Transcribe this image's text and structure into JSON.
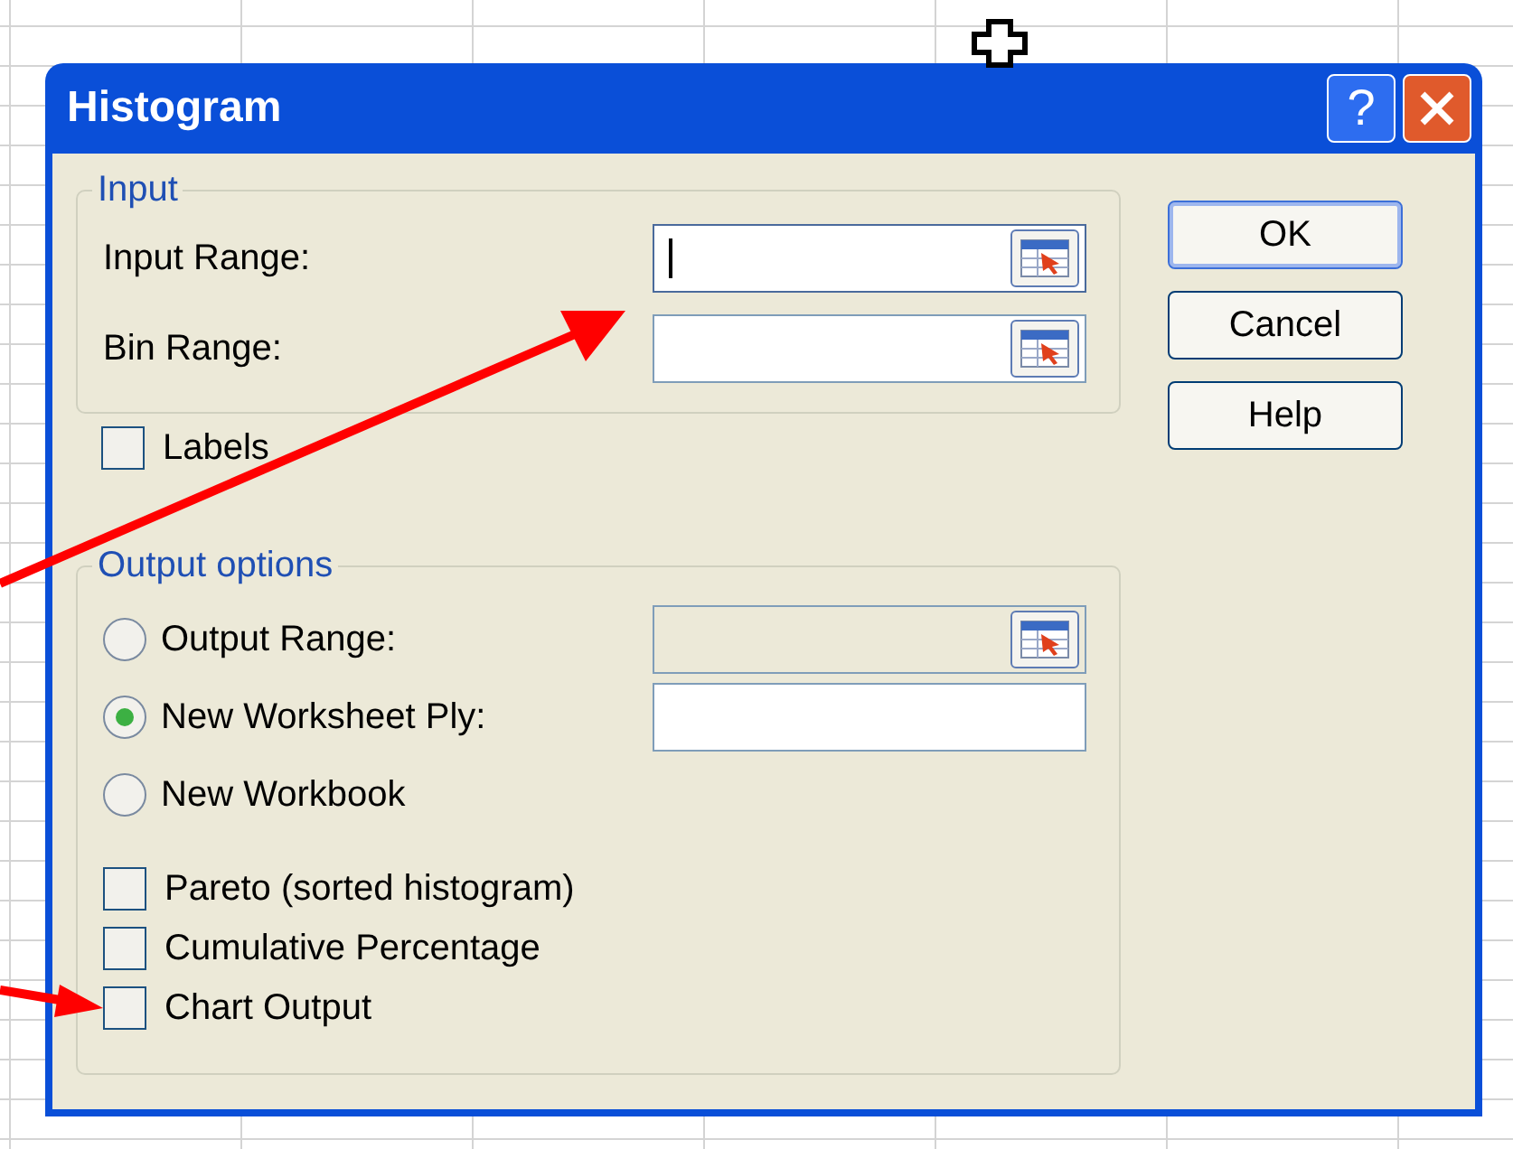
{
  "window": {
    "title": "Histogram",
    "help_button": "?"
  },
  "input_group": {
    "title": "Input",
    "fields": [
      {
        "label": "Input Range:",
        "focused": true
      },
      {
        "label": "Bin Range:",
        "focused": false
      }
    ]
  },
  "labels_checkbox": {
    "label": "Labels",
    "checked": false
  },
  "output_group": {
    "title": "Output options",
    "options": [
      {
        "label": "Output Range:",
        "selected": false,
        "field": {
          "kind": "picker",
          "disabled": true
        }
      },
      {
        "label": "New Worksheet Ply:",
        "selected": true,
        "field": {
          "kind": "plain",
          "disabled": false
        }
      },
      {
        "label": "New Workbook",
        "selected": false
      }
    ],
    "checkboxes": [
      {
        "label": "Pareto (sorted histogram)",
        "checked": false
      },
      {
        "label": "Cumulative Percentage",
        "checked": false
      },
      {
        "label": "Chart Output",
        "checked": false
      }
    ]
  },
  "buttons": [
    {
      "label": "OK",
      "default": true
    },
    {
      "label": "Cancel",
      "default": false
    },
    {
      "label": "Help",
      "default": false
    }
  ]
}
